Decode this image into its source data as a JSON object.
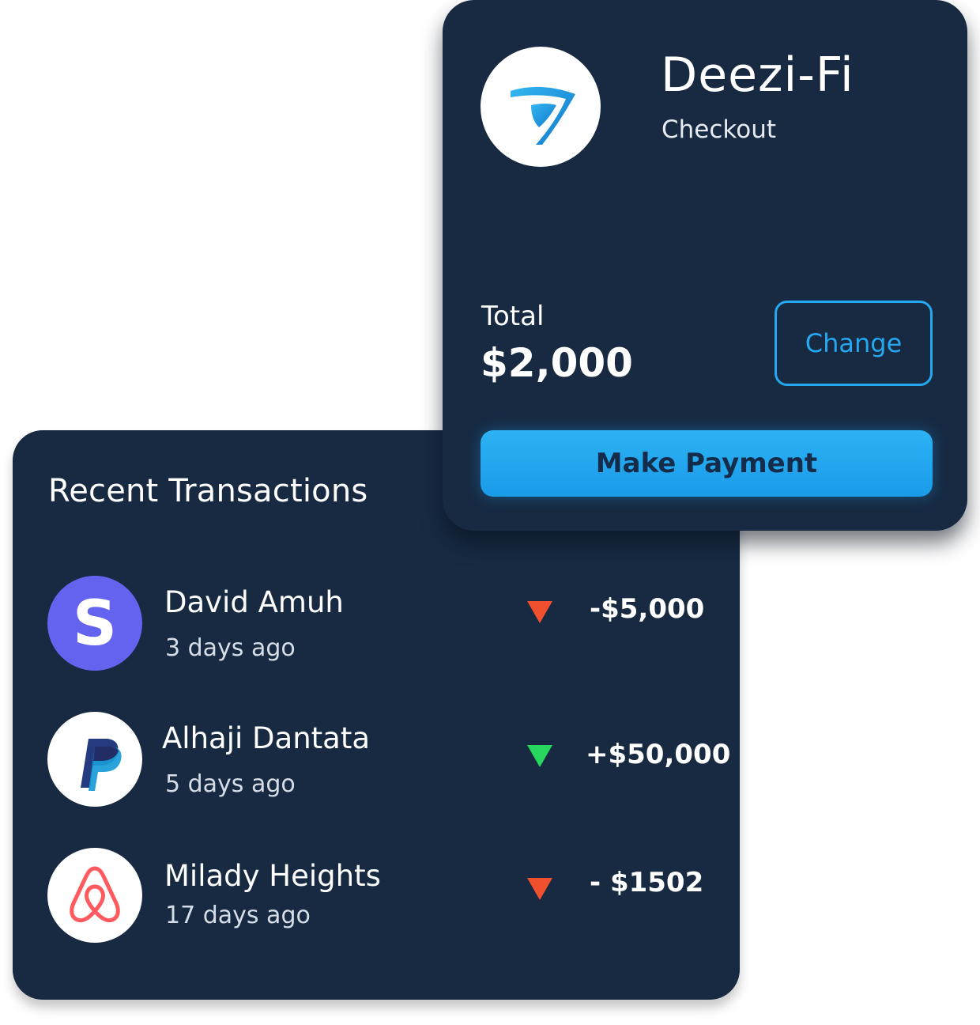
{
  "checkout": {
    "brand_name": "Deezi-Fi",
    "subtitle": "Checkout",
    "total_label": "Total",
    "total_value": "$2,000",
    "change_label": "Change",
    "pay_label": "Make Payment",
    "logo_icon": "deezi-fi-logo-icon",
    "colors": {
      "card": "#172a42",
      "accent": "#25a8ef",
      "button": "#1a9be8"
    }
  },
  "transactions": {
    "title": "Recent Transactions",
    "items": [
      {
        "name": "David Amuh",
        "time": "3 days ago",
        "amount": "-$5,000",
        "direction": "down",
        "icon": "stripe-logo-icon",
        "arrow_color": "#f0502e"
      },
      {
        "name": "Alhaji Dantata",
        "time": "5 days ago",
        "amount": "+$50,000",
        "direction": "down",
        "icon": "paypal-logo-icon",
        "arrow_color": "#27d65d"
      },
      {
        "name": "Milady Heights",
        "time": "17 days ago",
        "amount": "- $1502",
        "direction": "down",
        "icon": "airbnb-logo-icon",
        "arrow_color": "#f0502e"
      }
    ]
  }
}
